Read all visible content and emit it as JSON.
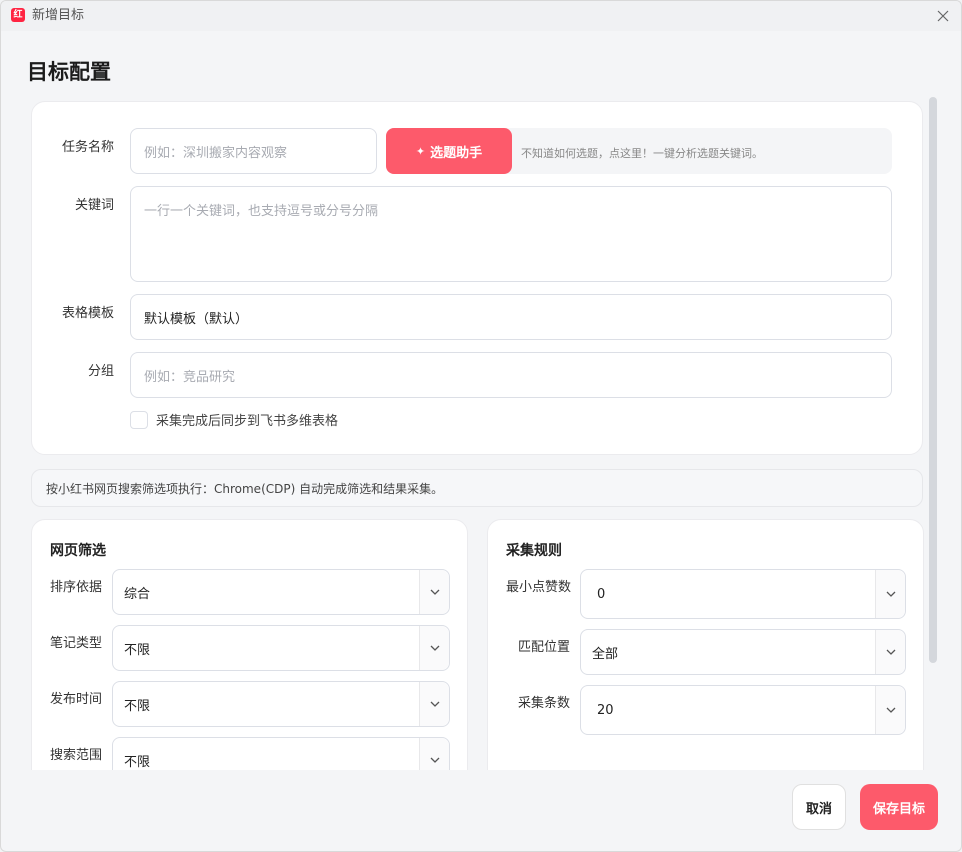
{
  "window": {
    "title": "新增目标",
    "app_icon": "xiaohongshu-logo-icon"
  },
  "page": {
    "title": "目标配置"
  },
  "form": {
    "task_name": {
      "label": "任务名称",
      "placeholder": "例如：深圳搬家内容观察"
    },
    "helper": {
      "button_label": "选题助手",
      "hint": "不知道如何选题，点这里！一键分析选题关键词。"
    },
    "keywords": {
      "label": "关键词",
      "placeholder": "一行一个关键词，也支持逗号或分号分隔"
    },
    "template": {
      "label": "表格模板",
      "value": "默认模板（默认）"
    },
    "group": {
      "label": "分组",
      "placeholder": "例如：竞品研究"
    },
    "sync_checkbox": {
      "label": "采集完成后同步到飞书多维表格",
      "checked": false
    }
  },
  "info_bar": {
    "text": "按小红书网页搜索筛选项执行：Chrome(CDP) 自动完成筛选和结果采集。"
  },
  "web_filter": {
    "title": "网页筛选",
    "fields": [
      {
        "label": "排序依据",
        "value": "综合"
      },
      {
        "label": "笔记类型",
        "value": "不限"
      },
      {
        "label": "发布时间",
        "value": "不限"
      },
      {
        "label": "搜索范围",
        "value": "不限"
      }
    ]
  },
  "collect_rules": {
    "title": "采集规则",
    "fields": [
      {
        "label": "最小点赞数",
        "value": "0"
      },
      {
        "label": "匹配位置",
        "value": "全部"
      },
      {
        "label": "采集条数",
        "value": "20"
      }
    ]
  },
  "footer": {
    "cancel_label": "取消",
    "save_label": "保存目标"
  },
  "colors": {
    "accent": "#fd5a6b",
    "brand": "#ff2442"
  }
}
